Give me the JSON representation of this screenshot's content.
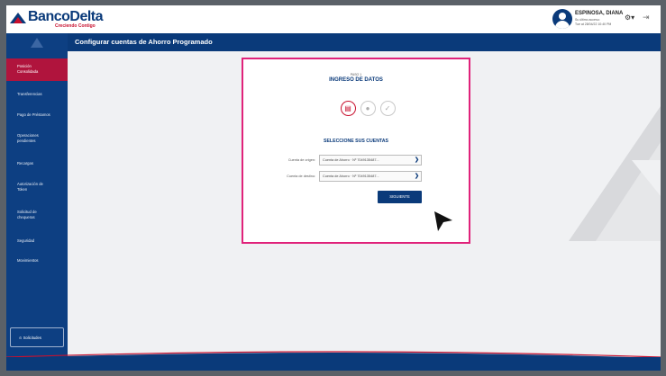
{
  "header": {
    "logo_text": "BancoDelta",
    "logo_tagline": "Creciendo Contigo",
    "user_name": "ESPINOSA, DIANA",
    "user_meta_line1": "Su último acceso:",
    "user_meta_line2": "Tue at 28/04/22 10:40 PM"
  },
  "page": {
    "title": "Configurar cuentas de Ahorro Programado"
  },
  "sidebar": {
    "items": [
      {
        "label_line1": "Posición",
        "label_line2": "Consolidada"
      },
      {
        "label_line1": "Transferencias",
        "label_line2": ""
      },
      {
        "label_line1": "Pago de Préstamos",
        "label_line2": ""
      },
      {
        "label_line1": "Operaciones",
        "label_line2": "pendientes"
      },
      {
        "label_line1": "Recargas",
        "label_line2": ""
      },
      {
        "label_line1": "Autorización de",
        "label_line2": "Token"
      },
      {
        "label_line1": "Solicitud de",
        "label_line2": "chequeras"
      },
      {
        "label_line1": "Seguridad",
        "label_line2": ""
      },
      {
        "label_line1": "Movimientos",
        "label_line2": ""
      }
    ],
    "bottom_button": "Solicitudes"
  },
  "card": {
    "step_label": "PASO 1",
    "step_title": "INGRESO DE DATOS",
    "select_heading": "SELECCIONE SUS CUENTAS",
    "origin_label": "Cuenta de origen:",
    "origin_value": "Cuenta de Ahorro · Nº 7049135487...",
    "dest_label": "Cuenta de destino:",
    "dest_value": "Cuenta de Ahorro · Nº 7049135487...",
    "next_label": "SIGUIENTE"
  },
  "colors": {
    "brand_blue": "#0a3a7a",
    "brand_red": "#c8102e",
    "highlight_pink": "#e0227a",
    "active_menu": "#b0143d"
  }
}
